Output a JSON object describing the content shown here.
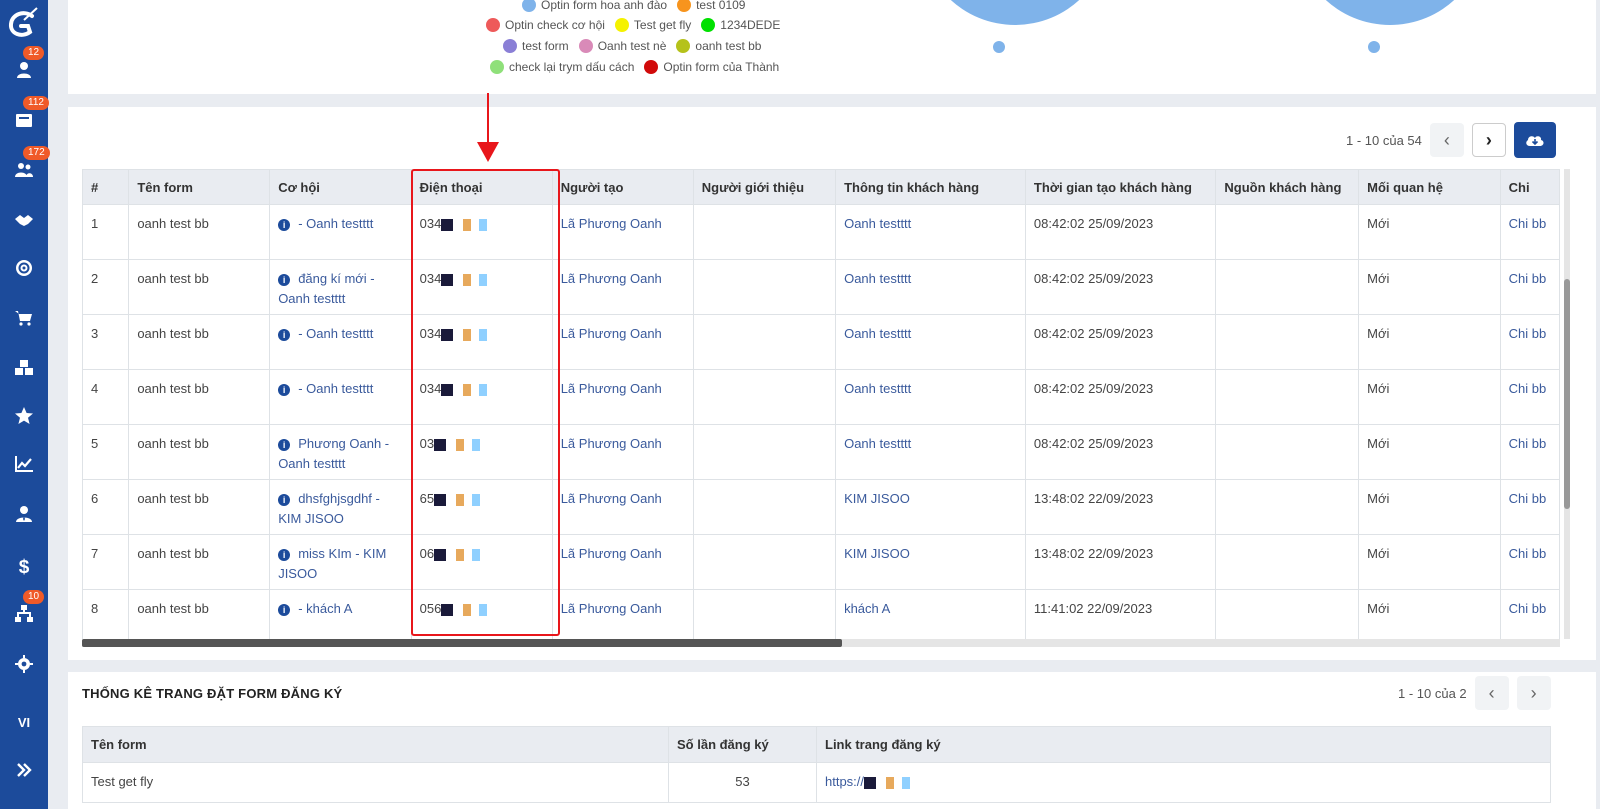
{
  "sidebar": {
    "items": [
      {
        "icon": "user-icon",
        "badge": "12"
      },
      {
        "icon": "inbox-icon",
        "badge": "112"
      },
      {
        "icon": "users-icon",
        "badge": "172"
      },
      {
        "icon": "handshake-icon",
        "badge": ""
      },
      {
        "icon": "target-icon",
        "badge": ""
      },
      {
        "icon": "cart-icon",
        "badge": ""
      },
      {
        "icon": "cubes-icon",
        "badge": ""
      },
      {
        "icon": "star-icon",
        "badge": ""
      },
      {
        "icon": "chart-line-icon",
        "badge": ""
      },
      {
        "icon": "user-tie-icon",
        "badge": ""
      },
      {
        "icon": "dollar-icon",
        "badge": ""
      },
      {
        "icon": "sitemap-icon",
        "badge": "10"
      },
      {
        "icon": "gear-icon",
        "badge": ""
      }
    ],
    "lang": "VI"
  },
  "legend": {
    "rows": [
      [
        {
          "label": "Optin form hoa anh đào",
          "color": "#7fb3ea"
        },
        {
          "label": "test 0109",
          "color": "#f7941d"
        }
      ],
      [
        {
          "label": "Optin check cơ hội",
          "color": "#ee5a5a"
        },
        {
          "label": "Test get fly",
          "color": "#f5f200"
        },
        {
          "label": "1234DEDE",
          "color": "#00e000"
        }
      ],
      [
        {
          "label": "test form",
          "color": "#8a7fd6"
        },
        {
          "label": "Oanh test nè",
          "color": "#d98ab8"
        },
        {
          "label": "oanh test bb",
          "color": "#b5c21a"
        }
      ],
      [
        {
          "label": "check lại trym dấu cách",
          "color": "#8fe07a"
        },
        {
          "label": "Optin form của Thành",
          "color": "#d10a0a"
        }
      ]
    ]
  },
  "main_table": {
    "pager_text": "1 - 10 của 54",
    "headers": [
      "#",
      "Tên form",
      "Cơ hội",
      "Điện thoại",
      "Người tạo",
      "Người giới thiệu",
      "Thông tin khách hàng",
      "Thời gian tạo khách hàng",
      "Nguồn khách hàng",
      "Mối quan hệ",
      "Chi"
    ],
    "rows": [
      {
        "n": "1",
        "form": "oanh test bb",
        "opp": "- Oanh testttt",
        "phone": "034",
        "creator": "Lã Phương Oanh",
        "ref": "",
        "cust": "Oanh testttt",
        "time": "08:42:02 25/09/2023",
        "src": "",
        "rel": "Mới",
        "extra": "Chi bb"
      },
      {
        "n": "2",
        "form": "oanh test bb",
        "opp": "đăng kí mới - Oanh testttt",
        "phone": "034",
        "creator": "Lã Phương Oanh",
        "ref": "",
        "cust": "Oanh testttt",
        "time": "08:42:02 25/09/2023",
        "src": "",
        "rel": "Mới",
        "extra": "Chi bb"
      },
      {
        "n": "3",
        "form": "oanh test bb",
        "opp": "- Oanh testttt",
        "phone": "034",
        "creator": "Lã Phương Oanh",
        "ref": "",
        "cust": "Oanh testttt",
        "time": "08:42:02 25/09/2023",
        "src": "",
        "rel": "Mới",
        "extra": "Chi bb"
      },
      {
        "n": "4",
        "form": "oanh test bb",
        "opp": "- Oanh testttt",
        "phone": "034",
        "creator": "Lã Phương Oanh",
        "ref": "",
        "cust": "Oanh testttt",
        "time": "08:42:02 25/09/2023",
        "src": "",
        "rel": "Mới",
        "extra": "Chi bb"
      },
      {
        "n": "5",
        "form": "oanh test bb",
        "opp": "Phương Oanh - Oanh testttt",
        "phone": "03",
        "creator": "Lã Phương Oanh",
        "ref": "",
        "cust": "Oanh testttt",
        "time": "08:42:02 25/09/2023",
        "src": "",
        "rel": "Mới",
        "extra": "Chi bb"
      },
      {
        "n": "6",
        "form": "oanh test bb",
        "opp": "dhsfghjsgdhf - KIM JISOO",
        "phone": "65",
        "creator": "Lã Phương Oanh",
        "ref": "",
        "cust": "KIM JISOO",
        "time": "13:48:02 22/09/2023",
        "src": "",
        "rel": "Mới",
        "extra": "Chi bb"
      },
      {
        "n": "7",
        "form": "oanh test bb",
        "opp": "miss KIm - KIM JISOO",
        "phone": "06",
        "creator": "Lã Phương Oanh",
        "ref": "",
        "cust": "KIM JISOO",
        "time": "13:48:02 22/09/2023",
        "src": "",
        "rel": "Mới",
        "extra": "Chi bb"
      },
      {
        "n": "8",
        "form": "oanh test bb",
        "opp": "- khách A",
        "phone": "056",
        "creator": "Lã Phương Oanh",
        "ref": "",
        "cust": "khách A",
        "time": "11:41:02 22/09/2023",
        "src": "",
        "rel": "Mới",
        "extra": "Chi bb"
      }
    ]
  },
  "stats": {
    "title": "THỐNG KÊ TRANG ĐẶT FORM ĐĂNG KÝ",
    "pager_text": "1 - 10 của 2",
    "headers": [
      "Tên form",
      "Số lần đăng ký",
      "Link trang đăng ký"
    ],
    "rows": [
      {
        "form": "Test get fly",
        "count": "53",
        "link": "https://"
      }
    ]
  }
}
